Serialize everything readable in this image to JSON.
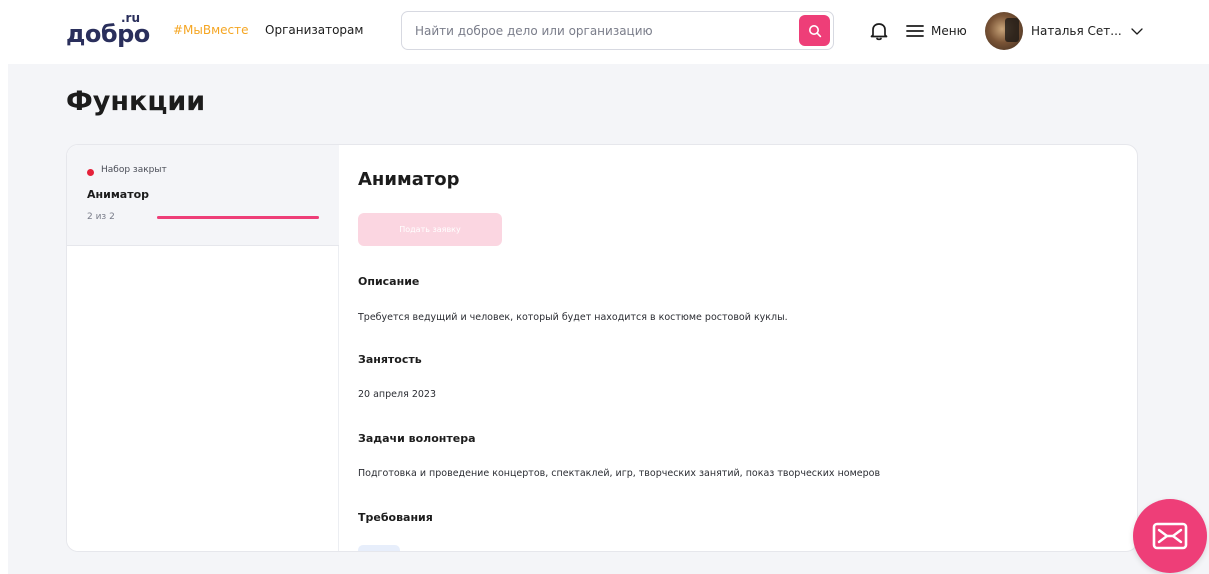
{
  "header": {
    "logo_main": "добро",
    "logo_ru": ".ru",
    "nav_together": "#МыВместе",
    "nav_organizers": "Организаторам",
    "search_placeholder": "Найти доброе дело или организацию",
    "menu_label": "Меню",
    "user_name": "Наталья Сет..."
  },
  "page": {
    "title": "Функции"
  },
  "sidebar": {
    "role": {
      "status": "Набор закрыт",
      "name": "Аниматор",
      "count": "2 из 2",
      "progress": 1.0
    }
  },
  "content": {
    "title": "Аниматор",
    "apply_label": "Подать заявку",
    "sections": [
      {
        "title": "Описание",
        "text": "Требуется ведущий и человек, который будет находится в костюме ростовой куклы."
      },
      {
        "title": "Занятость",
        "text": "20 апреля 2023"
      },
      {
        "title": "Задачи волонтера",
        "text": "Подготовка и проведение концертов, спектаклей, игр, творческих занятий, показ творческих номеров"
      },
      {
        "title": "Требования",
        "text": ""
      }
    ]
  },
  "icons": {
    "search": "search-icon",
    "bell": "bell-icon",
    "menu": "hamburger-icon",
    "chevron": "chevron-down-icon",
    "feedback": "mail-icon"
  },
  "colors": {
    "accent": "#ee3e78",
    "accent_light": "#fbd6e1",
    "hashtag": "#f5a623",
    "status_closed": "#e5213a",
    "logo": "#2a2f5c",
    "page_bg": "#f4f5f8"
  }
}
